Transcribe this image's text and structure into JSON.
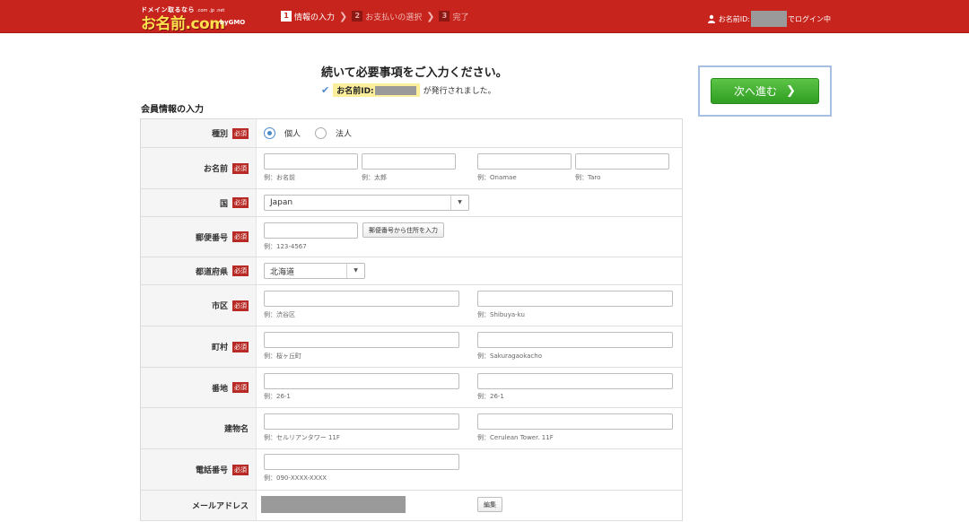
{
  "header": {
    "logo_small": "ドメイン取るなら",
    "logo_main": "お名前.com",
    "logo_tiny": ".com .jp .net",
    "logo_gmo": "byGMO",
    "steps": [
      {
        "num": "1",
        "label": "情報の入力"
      },
      {
        "num": "2",
        "label": "お支払いの選択"
      },
      {
        "num": "3",
        "label": "完了"
      }
    ],
    "login_prefix": "お名前ID:",
    "login_suffix": "でログイン中"
  },
  "lead": {
    "title": "続いて必要事項をご入力ください。",
    "issued_label": "お名前ID:",
    "issued_tail": "が発行されました。"
  },
  "next_button": {
    "label": "次へ進む",
    "chevron": "❯"
  },
  "section_title": "会員情報の入力",
  "required_label": "必須",
  "form": {
    "type": {
      "label": "種別",
      "options": [
        {
          "label": "個人",
          "selected": true
        },
        {
          "label": "法人",
          "selected": false
        }
      ]
    },
    "name": {
      "label": "お名前",
      "hints": [
        "例：お名前",
        "例：太郎",
        "例：Onamae",
        "例：Taro"
      ]
    },
    "country": {
      "label": "国",
      "value": "Japan"
    },
    "postal": {
      "label": "郵便番号",
      "button": "郵便番号から住所を入力",
      "hint": "例：123-4567"
    },
    "prefecture": {
      "label": "都道府県",
      "value": "北海道"
    },
    "city": {
      "label": "市区",
      "hints": [
        "例：渋谷区",
        "例：Shibuya-ku"
      ]
    },
    "town": {
      "label": "町村",
      "hints": [
        "例：桜ヶ丘町",
        "例：Sakuragaokacho"
      ]
    },
    "address": {
      "label": "番地",
      "hints": [
        "例：26-1",
        "例：26-1"
      ]
    },
    "building": {
      "label": "建物名",
      "hints": [
        "例：セルリアンタワー 11F",
        "例：Cerulean Tower. 11F"
      ]
    },
    "phone": {
      "label": "電話番号",
      "hint": "例：090-XXXX-XXXX"
    },
    "email": {
      "label": "メールアドレス",
      "edit_button": "編集"
    }
  },
  "colors": {
    "header": "#c7241e",
    "next_button": "#3fae30",
    "required_badge": "#b82a25",
    "radio_accent": "#4a8ac9"
  }
}
